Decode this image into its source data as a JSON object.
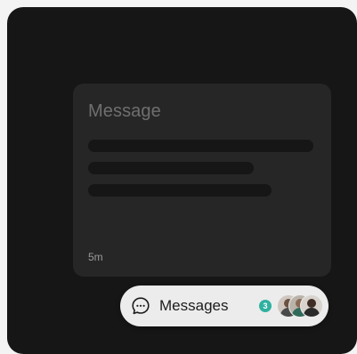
{
  "card": {
    "title": "Message",
    "time": "5m"
  },
  "messages_pill": {
    "label": "Messages",
    "badge_count": "3",
    "icon": "chat-bubble-icon",
    "avatars": [
      "avatar-1",
      "avatar-2",
      "avatar-3"
    ]
  },
  "colors": {
    "frame_bg": "#161616",
    "card_bg": "#262626",
    "pill_bg": "#ececec",
    "badge": "#2fb1a0"
  }
}
